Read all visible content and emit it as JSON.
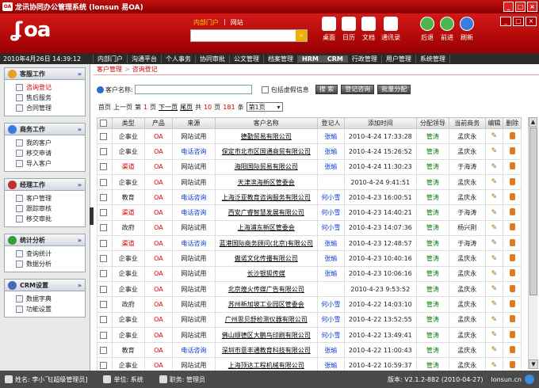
{
  "window": {
    "title": "龙讯协同办公管理系统 (lonsun 易OA)",
    "icon_text": "OA"
  },
  "header": {
    "logo": "oa",
    "search_tabs": [
      "内部门户",
      "网站"
    ],
    "tools": [
      {
        "label": "桌面",
        "icon": "home-icon",
        "color": "#ffffff"
      },
      {
        "label": "日历",
        "icon": "calendar-icon",
        "color": "#ffffff"
      },
      {
        "label": "文档",
        "icon": "document-icon",
        "color": "#ffffff"
      },
      {
        "label": "通讯录",
        "icon": "contacts-icon",
        "color": "#ffffff"
      },
      {
        "label": "后退",
        "icon": "back-icon",
        "color": "#4cb64c"
      },
      {
        "label": "前进",
        "icon": "forward-icon",
        "color": "#4cb64c"
      },
      {
        "label": "刷新",
        "icon": "refresh-icon",
        "color": "#3a7be0"
      }
    ]
  },
  "nav": {
    "datetime": "2010年4月26日 14:39:12",
    "items": [
      "内部门户",
      "沟通平台",
      "个人事务",
      "协同审批",
      "公文管理",
      "档案管理",
      "HRM",
      "CRM",
      "行政管理",
      "用户管理",
      "系统管理"
    ]
  },
  "sidebar": {
    "panels": [
      {
        "title": "客服工作",
        "items": [
          "咨询登记",
          "售后服务",
          "合同管理"
        ]
      },
      {
        "title": "商务工作",
        "items": [
          "我的客户",
          "移交申请",
          "导入客户"
        ]
      },
      {
        "title": "经理工作",
        "items": [
          "客户管理",
          "跟踪审核",
          "移交审批"
        ]
      },
      {
        "title": "统计分析",
        "items": [
          "查询统计",
          "数据分析"
        ]
      },
      {
        "title": "CRM设置",
        "items": [
          "数据字典",
          "功能设置"
        ]
      }
    ]
  },
  "breadcrumb": [
    "客户管理",
    "咨询登记"
  ],
  "filter": {
    "label": "客户名称:",
    "value": "",
    "checkbox_label": "包括虚假信息",
    "buttons": [
      "搜 索",
      "登记咨询",
      "批量分配"
    ]
  },
  "pager": {
    "first": "首页",
    "prev": "上一页",
    "di": "第",
    "current": "1",
    "ye1": "页",
    "next": "下一页",
    "last": "尾页",
    "gong1": "共",
    "pages": "10",
    "ye2": "页",
    "total": "181",
    "tiao": "条",
    "select_value": "第1页"
  },
  "table": {
    "headers": [
      "类型",
      "产品",
      "来源",
      "客户名称",
      "登记人",
      "添加时间",
      "分配领导",
      "当前商务",
      "编辑",
      "删除"
    ],
    "rows": [
      [
        "企事业",
        "OA",
        "网站试用",
        "德勤贸易有限公司",
        "张瑜",
        "2010-4-24 17:33:28",
        "管涛",
        "孟庆永"
      ],
      [
        "企事业",
        "OA",
        "电话咨询",
        "保定市北市区国通商贸有限公司",
        "张瑜",
        "2010-4-24 15:26:52",
        "管涛",
        "孟庆永"
      ],
      [
        "渠道",
        "OA",
        "网站试用",
        "海阳国际贸易有限公司",
        "张瑜",
        "2010-4-24 11:30:23",
        "管涛",
        "于海涛"
      ],
      [
        "企事业",
        "OA",
        "网站试用",
        "天津滨海新区管委会",
        "",
        "2010-4-24 9:41:51",
        "管涛",
        "孟庆永"
      ],
      [
        "教育",
        "OA",
        "电话咨询",
        "上海泛亚教育咨询服务有限公司",
        "何小雪",
        "2010-4-23 16:00:51",
        "管涛",
        "孟庆永"
      ],
      [
        "渠道",
        "OA",
        "电话咨询",
        "西安广睿智慧发展有限公司",
        "何小雪",
        "2010-4-23 14:40:21",
        "管涛",
        "于海涛"
      ],
      [
        "政府",
        "OA",
        "网站试用",
        "上海浦东新区管委会",
        "何小雪",
        "2010-4-23 14:07:36",
        "管涛",
        "杨兴刚"
      ],
      [
        "渠道",
        "OA",
        "电话咨询",
        "蓝港国际商务顾问(北京)有限公司",
        "张瑜",
        "2010-4-23 12:48:57",
        "管涛",
        "于海涛"
      ],
      [
        "企事业",
        "OA",
        "网站试用",
        "傲诺文化传播有限公司",
        "张瑜",
        "2010-4-23 10:40:16",
        "管涛",
        "孟庆永"
      ],
      [
        "企事业",
        "OA",
        "网站试用",
        "长沙银狐传媒",
        "张瑜",
        "2010-4-23 10:06:16",
        "管涛",
        "孟庆永"
      ],
      [
        "企事业",
        "OA",
        "网站试用",
        "北京煌火传媒广告有限公司",
        "",
        "2010-4-23 9:53:52",
        "管涛",
        "孟庆永"
      ],
      [
        "政府",
        "OA",
        "网站试用",
        "苏州新加坡工业园区管委会",
        "何小雪",
        "2010-4-22 14:03:10",
        "管涛",
        "孟庆永"
      ],
      [
        "企事业",
        "OA",
        "网站试用",
        "广州思贝舒检测仪器有限公司",
        "何小雪",
        "2010-4-22 13:52:55",
        "管涛",
        "孟庆永"
      ],
      [
        "企事业",
        "OA",
        "网站试用",
        "佛山顺德区大鹏鸟印刷有限公司",
        "何小雪",
        "2010-4-22 13:49:41",
        "管涛",
        "孟庆永"
      ],
      [
        "教育",
        "OA",
        "电话咨询",
        "深圳市意丰通教育科技有限公司",
        "张瑜",
        "2010-4-22 11:00:43",
        "管涛",
        "孟庆永"
      ],
      [
        "企事业",
        "OA",
        "网站试用",
        "上海顶达工程机械有限公司",
        "张瑜",
        "2010-4-22 10:59:37",
        "管涛",
        "孟庆永"
      ]
    ]
  },
  "status": {
    "user": "姓名: 李小飞[超级管理员]",
    "unit": "单位: 系统",
    "duty": "职务: 管理员",
    "version": "版本: V2.1.2-882 (2010-04-27)",
    "brand": "lonsun.cn"
  },
  "colors": {
    "brand_red": "#c01010",
    "link_blue": "#0a3ad6",
    "type_red": "#dd0000"
  }
}
